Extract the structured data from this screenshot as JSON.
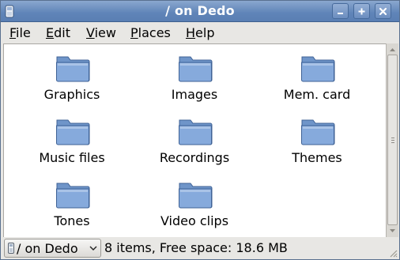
{
  "window": {
    "title": "/ on Dedo",
    "icons": {
      "app": "phone-icon",
      "minimize": "minimize-icon",
      "maximize": "maximize-icon",
      "close": "close-icon"
    }
  },
  "menu": {
    "items": [
      {
        "label": "File",
        "mnemonic": "F",
        "rest": "ile"
      },
      {
        "label": "Edit",
        "mnemonic": "E",
        "rest": "dit"
      },
      {
        "label": "View",
        "mnemonic": "V",
        "rest": "iew"
      },
      {
        "label": "Places",
        "mnemonic": "P",
        "rest": "laces"
      },
      {
        "label": "Help",
        "mnemonic": "H",
        "rest": "elp"
      }
    ]
  },
  "files": {
    "items": [
      {
        "name": "Graphics",
        "icon": "folder-icon"
      },
      {
        "name": "Images",
        "icon": "folder-icon"
      },
      {
        "name": "Mem. card",
        "icon": "folder-icon"
      },
      {
        "name": "Music files",
        "icon": "folder-icon"
      },
      {
        "name": "Recordings",
        "icon": "folder-icon"
      },
      {
        "name": "Themes",
        "icon": "folder-icon"
      },
      {
        "name": "Tones",
        "icon": "folder-icon"
      },
      {
        "name": "Video clips",
        "icon": "folder-icon"
      }
    ]
  },
  "statusbar": {
    "location": "/ on Dedo",
    "status": "8 items, Free space: 18.6 MB"
  },
  "colors": {
    "titlebar": "#5f84b8",
    "folder": "#7ea4d8",
    "content_bg": "#ffffff"
  }
}
